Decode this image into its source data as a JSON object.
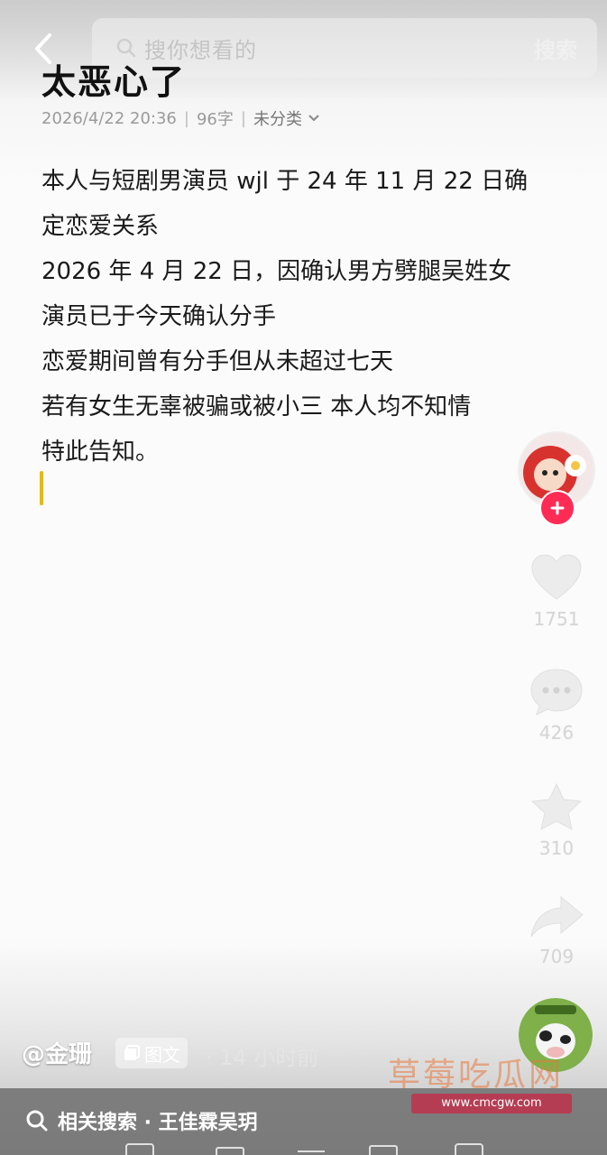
{
  "search": {
    "placeholder": "搜你想看的",
    "submit_label": "搜索"
  },
  "note": {
    "title": "太恶心了",
    "date": "2026/4/22 20:36",
    "word_count": "96字",
    "category": "未分类",
    "lines": [
      "本人与短剧男演员 wjl 于 24 年 11 月 22 日确",
      "定恋爱关系",
      "2026 年 4 月 22 日，因确认男方劈腿吴姓女",
      "演员已于今天确认分手",
      "恋爱期间曾有分手但从未超过七天",
      "若有女生无辜被骗或被小三 本人均不知情",
      "特此告知。"
    ]
  },
  "actions": {
    "likes": "1751",
    "comments": "426",
    "favorites": "310",
    "shares": "709"
  },
  "footer": {
    "author": "@金珊",
    "type_badge": "图文",
    "time_ago": "· 14 小时前",
    "related_search": "相关搜索 · 王佳霖吴玥"
  },
  "watermark": {
    "name": "草莓吃瓜网",
    "url": "www.cmcgw.com"
  },
  "colors": {
    "follow_red": "#fe2c55",
    "cursor_yellow": "#e3b81c",
    "watermark_orange": "#e8783c"
  },
  "icons": [
    "back-icon",
    "search-icon",
    "chevron-down-icon",
    "plus-icon",
    "heart-icon",
    "comment-icon",
    "star-icon",
    "share-icon",
    "image-text-icon"
  ]
}
